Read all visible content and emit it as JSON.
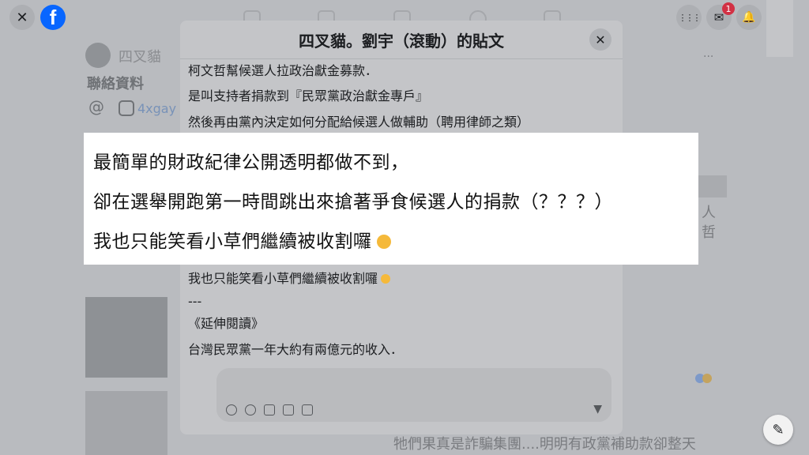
{
  "topbar": {
    "close_symbol": "✕",
    "logo_letter": "f",
    "notification_count": "1",
    "menu_symbol": "⋮⋮⋮",
    "messenger_symbol": "✉",
    "bell_symbol": "🔔"
  },
  "background": {
    "profile_name": "四叉貓",
    "contact_title": "聯絡資料",
    "ig_handle": "4xgay",
    "right_text_1": "人",
    "right_text_2": "哲",
    "bottom_text": "牠們果真是詐騙集團....明明有政黨補助款卻整天",
    "more_symbol": "..."
  },
  "dialog": {
    "title": "四叉貓。劉宇（滾動）的貼文",
    "close_symbol": "✕",
    "lines": [
      "柯文哲幫候選人拉政治獻金募款．",
      "是叫支持者捐款到『民眾黨政治獻金專戶』",
      "然後再由黨內決定如何分配給候選人做輔助（聘用律師之類）"
    ],
    "lower_lines": [
      "我也只能笑看小草們繼續被收割囉",
      "---",
      "《延伸閱讀》",
      "台灣民眾黨一年大約有兩億元的收入．"
    ],
    "send_symbol": "▼"
  },
  "overlay": {
    "line1": "最簡單的財政紀律公開透明都做不到，",
    "line2": "卻在選舉開跑第一時間跳出來搶著爭食候選人的捐款（？？？）",
    "line3": "我也只能笑看小草們繼續被收割囉"
  },
  "compose_symbol": "✎"
}
